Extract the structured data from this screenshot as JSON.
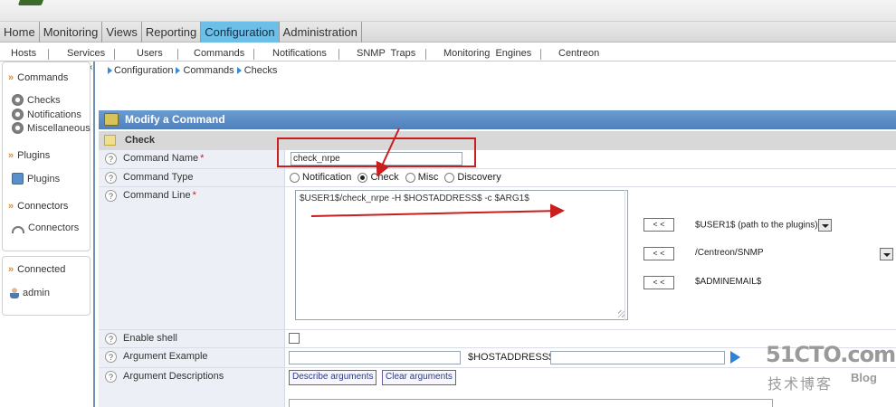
{
  "main_nav": [
    "Home",
    "Monitoring",
    "Views",
    "Reporting",
    "Configuration",
    "Administration"
  ],
  "sub_nav": [
    "Hosts",
    "Services",
    "Users",
    "Commands",
    "Notifications",
    "SNMP  Traps",
    "Monitoring  Engines",
    "Centreon"
  ],
  "sidebar": {
    "commands_header": "Commands",
    "commands_items": [
      "Checks",
      "Notifications",
      "Miscellaneous"
    ],
    "plugins_header": "Plugins",
    "plugins_item": "Plugins",
    "connectors_header": "Connectors",
    "connectors_item": "Connectors",
    "connected_header": "Connected",
    "connected_user": "admin"
  },
  "breadcrumb": [
    "Configuration",
    "Commands",
    "Checks"
  ],
  "form": {
    "title": "Modify a Command",
    "section": "Check",
    "command_name_label": "Command Name",
    "command_name_value": "check_nrpe",
    "command_type_label": "Command Type",
    "command_type_options": [
      "Notification",
      "Check",
      "Misc",
      "Discovery"
    ],
    "command_type_selected": "Check",
    "command_line_label": "Command Line",
    "command_line_value": "$USER1$/check_nrpe -H $HOSTADDRESS$ -c $ARG1$",
    "macro_button": "< <",
    "macro_selects": [
      "$USER1$ (path to the plugins)",
      "/Centreon/SNMP",
      "$ADMINEMAIL$"
    ],
    "enable_shell_label": "Enable shell",
    "argument_example_label": "Argument Example",
    "host_address_label": "$HOSTADDRESS$",
    "argument_descriptions_label": "Argument Descriptions",
    "describe_button": "Describe arguments",
    "clear_button": "Clear arguments"
  },
  "watermark": {
    "site": "51CTO.com",
    "subtitle": "技术博客",
    "blog": "Blog"
  },
  "colors": {
    "active_tab": "#6cc0e8",
    "title_bar": "#5a8cc6",
    "annotation_red": "#c81e1e"
  }
}
